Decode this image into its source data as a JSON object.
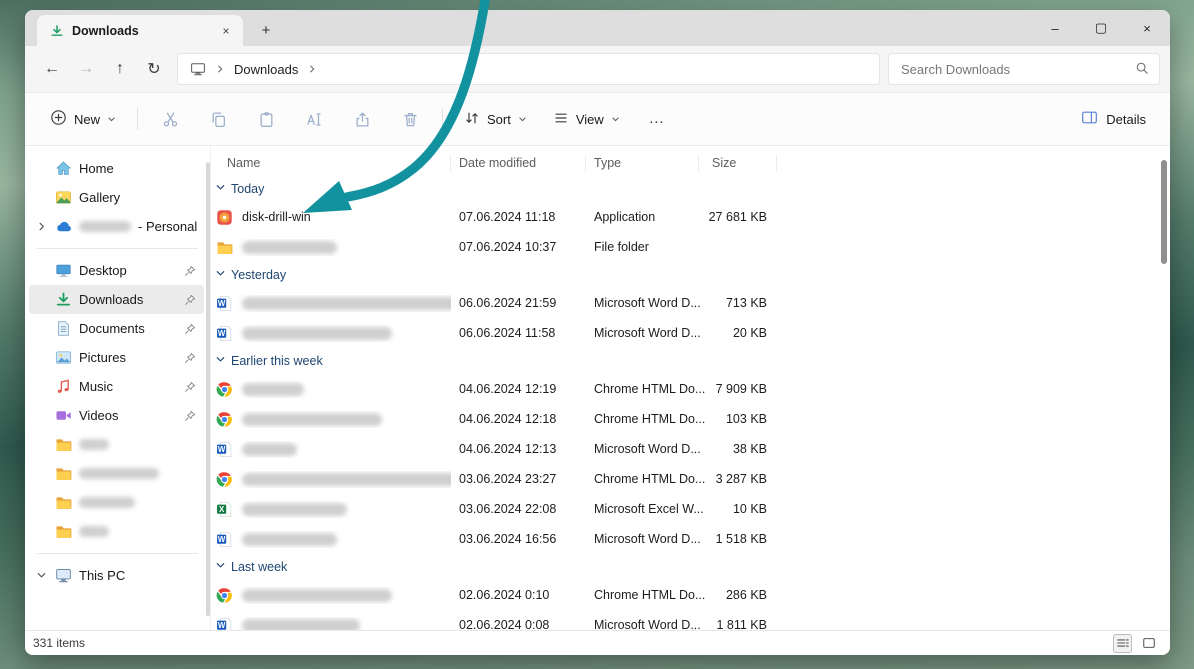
{
  "titlebar": {
    "tab_title": "Downloads"
  },
  "nav": {
    "breadcrumb": [
      "Downloads"
    ],
    "search_placeholder": "Search Downloads"
  },
  "toolbar": {
    "new": "New",
    "sort": "Sort",
    "view": "View",
    "more": "…",
    "details": "Details"
  },
  "sidebar": {
    "groups": [
      [
        {
          "id": "home",
          "label": "Home",
          "icon": "home"
        },
        {
          "id": "gallery",
          "label": "Gallery",
          "icon": "gallery"
        },
        {
          "id": "onedrive-personal",
          "label": "- Personal",
          "icon": "onedrive",
          "expand": "right",
          "redacted": true,
          "redact_w": 52
        }
      ],
      [
        {
          "id": "desktop",
          "label": "Desktop",
          "icon": "desktop",
          "pinned": true
        },
        {
          "id": "downloads",
          "label": "Downloads",
          "icon": "downloads",
          "pinned": true,
          "selected": true
        },
        {
          "id": "documents",
          "label": "Documents",
          "icon": "documents",
          "pinned": true
        },
        {
          "id": "pictures",
          "label": "Pictures",
          "icon": "pictures",
          "pinned": true
        },
        {
          "id": "music",
          "label": "Music",
          "icon": "music",
          "pinned": true
        },
        {
          "id": "videos",
          "label": "Videos",
          "icon": "videos",
          "pinned": true
        },
        {
          "id": "folder-1",
          "icon": "folder",
          "redacted": true,
          "redact_w": 30
        },
        {
          "id": "folder-2",
          "icon": "folder",
          "redacted": true,
          "redact_w": 80
        },
        {
          "id": "folder-3",
          "icon": "folder",
          "redacted": true,
          "redact_w": 56
        },
        {
          "id": "folder-4",
          "icon": "folder",
          "redacted": true,
          "redact_w": 30
        }
      ],
      [
        {
          "id": "this-pc",
          "label": "This PC",
          "icon": "thispc",
          "expand": "down"
        }
      ]
    ]
  },
  "files": {
    "columns": [
      "Name",
      "Date modified",
      "Type",
      "Size"
    ],
    "groups": [
      {
        "label": "Today",
        "rows": [
          {
            "icon": "diskdrill",
            "name": "disk-drill-win",
            "date": "07.06.2024 11:18",
            "type": "Application",
            "size": "27 681 KB"
          },
          {
            "icon": "folder",
            "redact_w": 95,
            "date": "07.06.2024 10:37",
            "type": "File folder",
            "size": ""
          }
        ]
      },
      {
        "label": "Yesterday",
        "rows": [
          {
            "icon": "word",
            "redact_w": 225,
            "date": "06.06.2024 21:59",
            "type": "Microsoft Word D...",
            "size": "713 KB"
          },
          {
            "icon": "word",
            "redact_w": 150,
            "date": "06.06.2024 11:58",
            "type": "Microsoft Word D...",
            "size": "20 KB"
          }
        ]
      },
      {
        "label": "Earlier this week",
        "rows": [
          {
            "icon": "chrome",
            "redact_w": 62,
            "date": "04.06.2024 12:19",
            "type": "Chrome HTML Do...",
            "size": "7 909 KB"
          },
          {
            "icon": "chrome",
            "redact_w": 140,
            "date": "04.06.2024 12:18",
            "type": "Chrome HTML Do...",
            "size": "103 KB"
          },
          {
            "icon": "word",
            "redact_w": 55,
            "date": "04.06.2024 12:13",
            "type": "Microsoft Word D...",
            "size": "38 KB"
          },
          {
            "icon": "chrome",
            "redact_w": 225,
            "date": "03.06.2024 23:27",
            "type": "Chrome HTML Do...",
            "size": "3 287 KB"
          },
          {
            "icon": "excel",
            "redact_w": 105,
            "date": "03.06.2024 22:08",
            "type": "Microsoft Excel W...",
            "size": "10 KB"
          },
          {
            "icon": "word",
            "redact_w": 95,
            "date": "03.06.2024 16:56",
            "type": "Microsoft Word D...",
            "size": "1 518 KB"
          }
        ]
      },
      {
        "label": "Last week",
        "rows": [
          {
            "icon": "chrome",
            "redact_w": 150,
            "date": "02.06.2024 0:10",
            "type": "Chrome HTML Do...",
            "size": "286 KB"
          },
          {
            "icon": "word",
            "redact_w": 118,
            "date": "02.06.2024 0:08",
            "type": "Microsoft Word D...",
            "size": "1 811 KB"
          }
        ]
      }
    ]
  },
  "statusbar": {
    "items_count": "331 items"
  },
  "annotation": {
    "type": "arrow",
    "color": "#12919e",
    "points_to": "disk-drill-win"
  }
}
